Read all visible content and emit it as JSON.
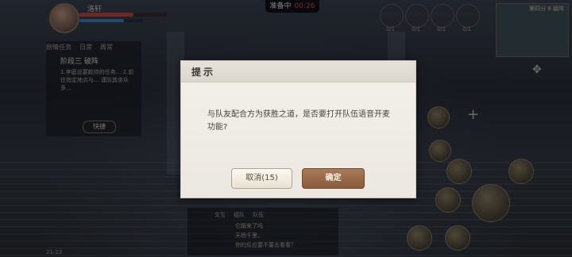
{
  "hud": {
    "player_name": "洛轩",
    "hp_fraction": 0.62,
    "mp_fraction": 0.7,
    "ready_label": "准备中",
    "ready_timer": "00:26"
  },
  "quest": {
    "tabs": [
      "剧情任务",
      "日常",
      "周常"
    ],
    "title": "阶段三  破阵",
    "description": "1.李庭设宴款待的任务... 2.前往指定地点与... 谨防其余众多...",
    "button_label": "快捷"
  },
  "team_slots": [
    "0/1",
    "0/1",
    "0/1",
    "0/1"
  ],
  "minimap": {
    "label": "第四分 8 级阵"
  },
  "chat": {
    "tabs": [
      "交互",
      "组队",
      "队伍"
    ],
    "lines": [
      "它跟来了吗",
      "天杨千里。",
      "你的反应要不要去看看？"
    ]
  },
  "status_bar": {
    "time": "21:23"
  },
  "dialog": {
    "title": "提示",
    "message": "与队友配合方为获胜之道，是否要打开队伍语音开麦功能?",
    "cancel_label": "取消(15)",
    "confirm_label": "确定"
  },
  "colors": {
    "dialog_bg": "#efebe4",
    "confirm_btn": "#98694a",
    "timer_red": "#e34a46"
  }
}
